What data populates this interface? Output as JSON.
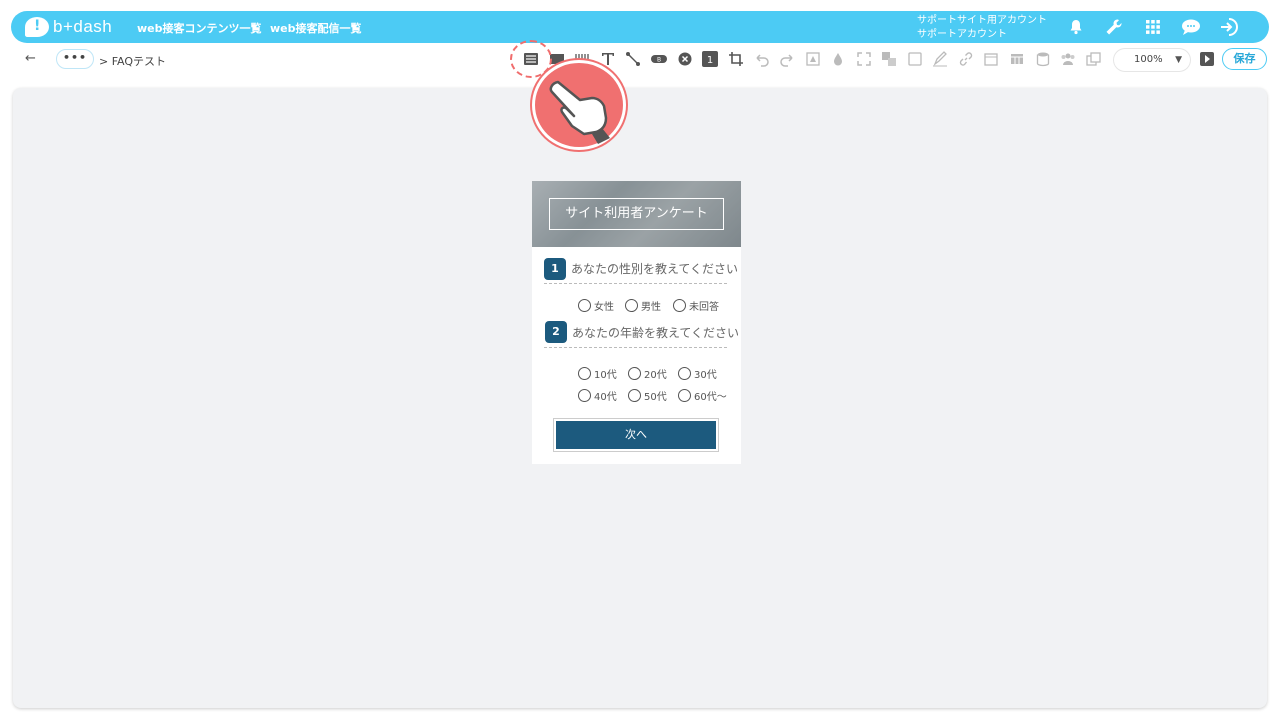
{
  "header": {
    "logo_text": "b+dash",
    "nav": [
      {
        "label": "web接客コンテンツ一覧"
      },
      {
        "label": "web接客配信一覧"
      }
    ],
    "account_line1": "サポートサイト用アカウント",
    "account_line2": "サポートアカウント",
    "icons": [
      "bell-icon",
      "wrench-icon",
      "grid-icon",
      "chat-icon",
      "logout-icon"
    ]
  },
  "toolbar": {
    "more_label": "•••",
    "breadcrumb": "> FAQテスト",
    "zoom": "100%",
    "save_label": "保存",
    "tools": [
      "list-icon",
      "image-icon",
      "barcode-icon",
      "text-icon",
      "connector-icon",
      "tag-icon",
      "close-circle-icon",
      "number-icon",
      "crop-icon",
      "undo-icon",
      "redo-icon",
      "frame-icon",
      "drop-icon",
      "fullscreen-icon",
      "layer-icon",
      "square-icon",
      "pen-icon",
      "link-icon",
      "calendar-icon",
      "table-icon",
      "database-icon",
      "people-icon",
      "copy-icon"
    ]
  },
  "survey": {
    "title": "サイト利用者アンケート",
    "questions": [
      {
        "number": "1",
        "text": "あなたの性別を教えてください",
        "options": [
          "女性",
          "男性",
          "未回答"
        ]
      },
      {
        "number": "2",
        "text": "あなたの年齢を教えてください",
        "options": [
          "10代",
          "20代",
          "30代",
          "40代",
          "50代",
          "60代～"
        ]
      }
    ],
    "next_label": "次へ"
  },
  "colors": {
    "accent": "#4ccbf4",
    "survey_primary": "#1c5a7e",
    "highlight": "#f07070"
  }
}
